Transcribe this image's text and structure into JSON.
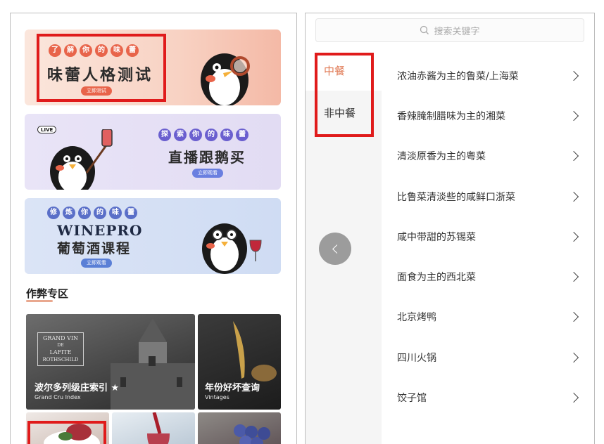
{
  "left": {
    "banner1": {
      "circles": [
        "了",
        "解",
        "你",
        "的",
        "味",
        "蕾"
      ],
      "title": "味蕾人格测试",
      "button": "立即测试"
    },
    "banner2": {
      "live": "LIVE",
      "circles": [
        "探",
        "索",
        "你",
        "的",
        "味",
        "蕾"
      ],
      "title": "直播跟鹅买",
      "button": "立即观看"
    },
    "banner3": {
      "circles": [
        "修",
        "炼",
        "你",
        "的",
        "味",
        "蕾"
      ],
      "title_en": "WINEPRO",
      "title": "葡萄酒课程",
      "button": "立即观看"
    },
    "section_title": "作弊专区",
    "tiles": {
      "grand_cru": {
        "title": "波尔多列级庄索引 ★",
        "subtitle": "Grand Cru Index",
        "logo_lines": [
          "GRAND VIN",
          "DE",
          "LAFITE",
          "ROTHSCHILD"
        ]
      },
      "vintages": {
        "title": "年份好坏查询",
        "subtitle": "Vintages"
      }
    }
  },
  "right": {
    "search_placeholder": "搜索关键字",
    "sidebar": [
      {
        "label": "中餐",
        "active": true
      },
      {
        "label": "非中餐",
        "active": false
      }
    ],
    "categories": [
      "浓油赤酱为主的鲁菜/上海菜",
      "香辣腌制腊味为主的湘菜",
      "清淡原香为主的粤菜",
      "比鲁菜清淡些的咸鲜口浙菜",
      "咸中带甜的苏锡菜",
      "面食为主的西北菜",
      "北京烤鸭",
      "四川火锅",
      "饺子馆"
    ]
  },
  "colors": {
    "highlight_box": "#e01b1b",
    "active_tab": "#e07a55"
  }
}
